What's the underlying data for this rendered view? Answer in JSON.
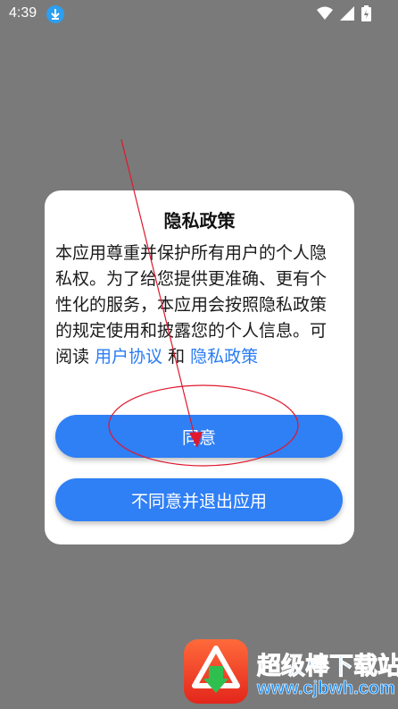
{
  "status_bar": {
    "time": "4:39",
    "icons": [
      "download-icon",
      "wifi-icon",
      "signal-icon",
      "battery-icon"
    ]
  },
  "dialog": {
    "title": "隐私政策",
    "body_text": "本应用尊重并保护所有用户的个人隐私权。为了给您提供更准确、更有个性化的服务，本应用会按照隐私政策的规定使用和披露您的个人信息。可阅读 ",
    "link_user_agreement": "用户协议",
    "conjunction": " 和 ",
    "link_privacy_policy": "隐私政策",
    "agree_button": "同意",
    "disagree_button": "不同意并退出应用"
  },
  "watermark": {
    "name": "超级棒下载站",
    "url": "www.cjbwh.com"
  },
  "colors": {
    "overlay": "#7a7a7a",
    "accent": "#2f7ff5",
    "link": "#2a7cf3",
    "annotation": "#e0182d"
  }
}
